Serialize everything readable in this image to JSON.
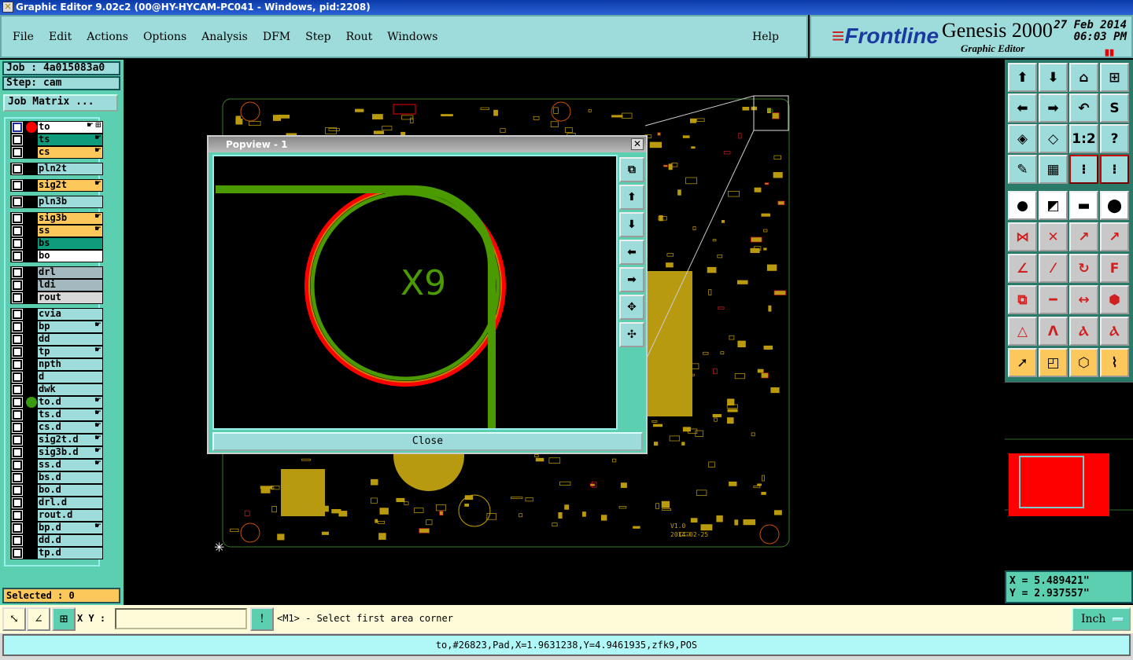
{
  "window": {
    "title": "Graphic Editor 9.02c2 (00@HY-HYCAM-PC041 - Windows, pid:2208)"
  },
  "menu": {
    "items": [
      "File",
      "Edit",
      "Actions",
      "Options",
      "Analysis",
      "DFM",
      "Step",
      "Rout",
      "Windows"
    ],
    "help": "Help"
  },
  "brand": {
    "logo": "Frontline",
    "product": "Genesis 2000",
    "subtitle": "Graphic Editor",
    "date": "27 Feb 2014",
    "time": "06:03 PM"
  },
  "job": {
    "job": "Job : 4a015083a0",
    "step": "Step: cam",
    "matrix_button": "Job Matrix ..."
  },
  "layers": [
    {
      "name": "to",
      "color": "#ffffff",
      "hand": true,
      "marker": "#ff0000",
      "active": true
    },
    {
      "name": "ts",
      "color": "#0e9c7c",
      "hand": true
    },
    {
      "name": "cs",
      "color": "#fcc85c",
      "hand": true
    },
    {
      "name": "pln2t",
      "color": "#9edcdc"
    },
    {
      "name": "sig2t",
      "color": "#fcc85c",
      "hand": true
    },
    {
      "name": "pln3b",
      "color": "#9edcdc"
    },
    {
      "name": "sig3b",
      "color": "#fcc85c",
      "hand": true
    },
    {
      "name": "ss",
      "color": "#fcc85c",
      "hand": true
    },
    {
      "name": "bs",
      "color": "#0e9c7c"
    },
    {
      "name": "bo",
      "color": "#ffffff"
    },
    {
      "name": "drl",
      "color": "#a3b8bf"
    },
    {
      "name": "ldi",
      "color": "#a3b8bf"
    },
    {
      "name": "rout",
      "color": "#d8d8d8"
    },
    {
      "name": "cvia",
      "color": "#9edcdc"
    },
    {
      "name": "bp",
      "color": "#9edcdc",
      "hand": true
    },
    {
      "name": "dd",
      "color": "#9edcdc"
    },
    {
      "name": "tp",
      "color": "#9edcdc",
      "hand": true
    },
    {
      "name": "npth",
      "color": "#9edcdc"
    },
    {
      "name": "d",
      "color": "#9edcdc"
    },
    {
      "name": "dwk",
      "color": "#9edcdc"
    },
    {
      "name": "to.d",
      "color": "#9edcdc",
      "hand": true,
      "marker": "#3a9a10"
    },
    {
      "name": "ts.d",
      "color": "#9edcdc",
      "hand": true
    },
    {
      "name": "cs.d",
      "color": "#9edcdc",
      "hand": true
    },
    {
      "name": "sig2t.d",
      "color": "#9edcdc",
      "hand": true
    },
    {
      "name": "sig3b.d",
      "color": "#9edcdc",
      "hand": true
    },
    {
      "name": "ss.d",
      "color": "#9edcdc",
      "hand": true
    },
    {
      "name": "bs.d",
      "color": "#9edcdc"
    },
    {
      "name": "bo.d",
      "color": "#9edcdc"
    },
    {
      "name": "drl.d",
      "color": "#9edcdc"
    },
    {
      "name": "rout.d",
      "color": "#9edcdc"
    },
    {
      "name": "bp.d",
      "color": "#9edcdc",
      "hand": true
    },
    {
      "name": "dd.d",
      "color": "#9edcdc"
    },
    {
      "name": "tp.d",
      "color": "#9edcdc"
    }
  ],
  "selected": "Selected : 0",
  "board": {
    "label_version": "V1.0",
    "label_date": "2014-02-25",
    "corner_label": "X9"
  },
  "popview": {
    "title": "Popview - 1",
    "feature_label": "X9",
    "close": "Close",
    "tools": [
      "zoom-home-icon",
      "pan-up-icon",
      "pan-down-icon",
      "pan-left-icon",
      "pan-right-icon",
      "zoom-in-icon",
      "zoom-out-icon"
    ]
  },
  "toolbar": {
    "tools": [
      {
        "icon": "pan-up-icon",
        "glyph": "⬆"
      },
      {
        "icon": "pan-down-icon",
        "glyph": "⬇"
      },
      {
        "icon": "home-icon",
        "glyph": "⌂"
      },
      {
        "icon": "xy-grid-icon",
        "glyph": "⊞"
      },
      {
        "icon": "pan-left-icon",
        "glyph": "⬅"
      },
      {
        "icon": "pan-right-icon",
        "glyph": "➡"
      },
      {
        "icon": "undo-view-icon",
        "glyph": "↶"
      },
      {
        "icon": "snap-icon",
        "glyph": "S"
      },
      {
        "icon": "zoom-in-icon",
        "glyph": "◈"
      },
      {
        "icon": "zoom-out-icon",
        "glyph": "◇"
      },
      {
        "icon": "ratio-icon",
        "glyph": "1:2"
      },
      {
        "icon": "help-icon",
        "glyph": "?"
      },
      {
        "icon": "tools-icon",
        "glyph": "✎"
      },
      {
        "icon": "grid-icon",
        "glyph": "▦"
      },
      {
        "icon": "netlist-icon",
        "glyph": "⁝"
      },
      {
        "icon": "netlist-red-icon",
        "glyph": "⁝"
      },
      {
        "icon": "add-feature-icon",
        "glyph": "●"
      },
      {
        "icon": "copy-icon",
        "glyph": "◩"
      },
      {
        "icon": "measure-icon",
        "glyph": "▬"
      },
      {
        "icon": "pad-icon",
        "glyph": "⬤"
      },
      {
        "icon": "connect-icon",
        "glyph": "⋈"
      },
      {
        "icon": "delete-icon",
        "glyph": "✕"
      },
      {
        "icon": "move-icon",
        "glyph": "↗"
      },
      {
        "icon": "move-pad-icon",
        "glyph": "↗"
      },
      {
        "icon": "line-angle-icon",
        "glyph": "∠"
      },
      {
        "icon": "line-move-icon",
        "glyph": "⁄"
      },
      {
        "icon": "rotate-icon",
        "glyph": "↻"
      },
      {
        "icon": "mirror-icon",
        "glyph": "F"
      },
      {
        "icon": "move-rect-icon",
        "glyph": "⧉"
      },
      {
        "icon": "break-line-icon",
        "glyph": "━"
      },
      {
        "icon": "dimension-icon",
        "glyph": "↔"
      },
      {
        "icon": "shapes-icon",
        "glyph": "⬢"
      },
      {
        "icon": "slivers-icon",
        "glyph": "△"
      },
      {
        "icon": "arc-icon",
        "glyph": "Λ"
      },
      {
        "icon": "arc-edit-icon",
        "glyph": "Ⲁ"
      },
      {
        "icon": "arc-cut-icon",
        "glyph": "Ⲁ"
      },
      {
        "icon": "select-icon",
        "glyph": "➚"
      },
      {
        "icon": "select-rect-icon",
        "glyph": "◰"
      },
      {
        "icon": "select-poly-icon",
        "glyph": "⬡"
      },
      {
        "icon": "select-net-icon",
        "glyph": "⌇"
      }
    ]
  },
  "coords": {
    "x": "X = 5.489421\"",
    "y": "Y = 2.937557\""
  },
  "bottom": {
    "xy_label": "X Y :",
    "xy_value": "",
    "prompt": "<M1> - Select first area corner",
    "units": "Inch"
  },
  "status": "to,#26823,Pad,X=1.9631238,Y=4.9461935,zfk9,POS",
  "colors": {
    "panel": "#9edcdc",
    "teal": "#5ccfb0",
    "trace": "#4a9a00",
    "pad": "#ff0000",
    "board": "#c8a000"
  }
}
